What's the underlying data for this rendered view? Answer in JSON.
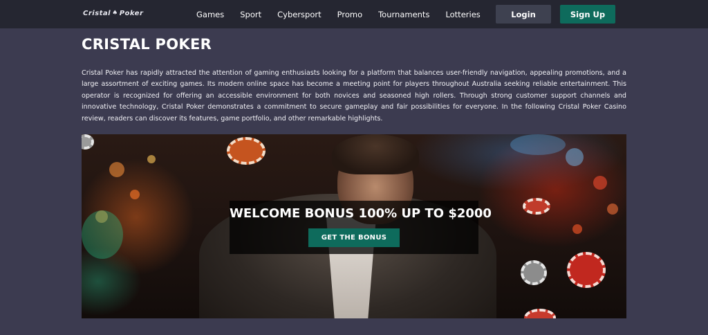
{
  "brand": {
    "logo_text_left": "Cristal",
    "logo_text_right": "Poker"
  },
  "nav": {
    "items": [
      {
        "label": "Games"
      },
      {
        "label": "Sport"
      },
      {
        "label": "Cybersport"
      },
      {
        "label": "Promo"
      },
      {
        "label": "Tournaments"
      },
      {
        "label": "Lotteries"
      }
    ]
  },
  "auth": {
    "login_label": "Login",
    "signup_label": "Sign Up"
  },
  "main": {
    "title": "CRISTAL POKER",
    "intro": "Cristal Poker has rapidly attracted the attention of gaming enthusiasts looking for a platform that balances user-friendly navigation, appealing promotions, and a large assortment of exciting games. Its modern online space has become a meeting point for players throughout Australia seeking reliable entertainment. This operator is recognized for offering an accessible environment for both novices and seasoned high rollers. Through strong customer support channels and innovative technology, Cristal Poker demonstrates a commitment to secure gameplay and fair possibilities for everyone. In the following Cristal Poker Casino review, readers can discover its features, game portfolio, and other remarkable highlights."
  },
  "banner": {
    "headline": "WELCOME BONUS 100% UP TO $2000",
    "cta_label": "GET THE BONUS"
  },
  "colors": {
    "page_bg": "#3c3b50",
    "header_bg": "#252631",
    "accent": "#0e6b5c",
    "login_bg": "#3e4150"
  }
}
